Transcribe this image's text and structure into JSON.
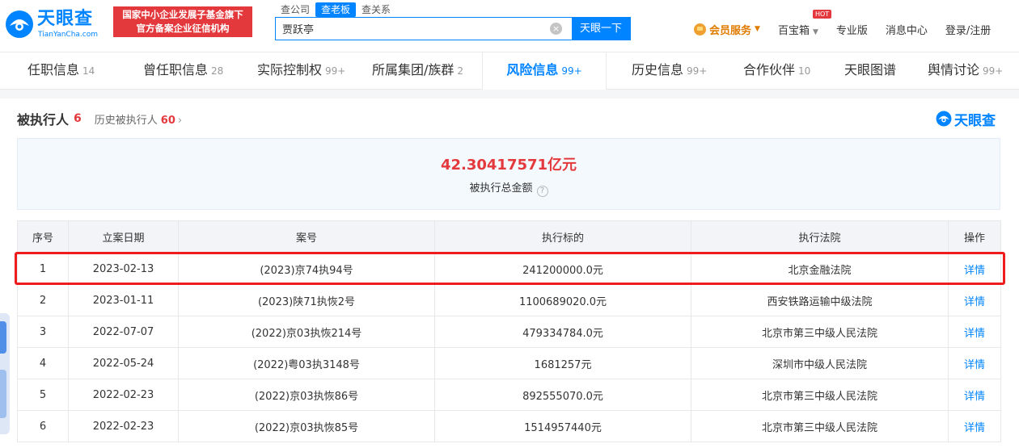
{
  "header": {
    "logo_cn": "天眼查",
    "logo_en": "TianYanCha.com",
    "badge_line1": "国家中小企业发展子基金旗下",
    "badge_line2": "官方备案企业征信机构",
    "search_tabs": [
      "查公司",
      "查老板",
      "查关系"
    ],
    "active_search_tab": "查老板",
    "search_value": "贾跃亭",
    "search_button": "天眼一下",
    "nav": {
      "vip": "会员服务",
      "baibao": "百宝箱",
      "hot": "HOT",
      "pro": "专业版",
      "messages": "消息中心",
      "login": "登录/注册"
    }
  },
  "tabs": [
    {
      "label": "任职信息",
      "count": "14"
    },
    {
      "label": "曾任职信息",
      "count": "28"
    },
    {
      "label": "实际控制权",
      "count": "99+"
    },
    {
      "label": "所属集团/族群",
      "count": "2"
    },
    {
      "label": "风险信息",
      "count": "99+"
    },
    {
      "label": "历史信息",
      "count": "99+"
    },
    {
      "label": "合作伙伴",
      "count": "10"
    },
    {
      "label": "天眼图谱",
      "count": ""
    },
    {
      "label": "舆情讨论",
      "count": "99+"
    }
  ],
  "active_tab": "风险信息",
  "section": {
    "title": "被执行人",
    "count": "6",
    "history_label": "历史被执行人",
    "history_count": "60",
    "brand": "天眼查"
  },
  "summary": {
    "amount": "42.30417571亿元",
    "label": "被执行总金额"
  },
  "table": {
    "headers": [
      "序号",
      "立案日期",
      "案号",
      "执行标的",
      "执行法院",
      "操作"
    ],
    "rows": [
      [
        "1",
        "2023-02-13",
        "(2023)京74执94号",
        "241200000.0元",
        "北京金融法院",
        "详情"
      ],
      [
        "2",
        "2023-01-11",
        "(2023)陕71执恢2号",
        "1100689020.0元",
        "西安铁路运输中级法院",
        "详情"
      ],
      [
        "3",
        "2022-07-07",
        "(2022)京03执恢214号",
        "479334784.0元",
        "北京市第三中级人民法院",
        "详情"
      ],
      [
        "4",
        "2022-05-24",
        "(2022)粤03执3148号",
        "1681257元",
        "深圳市中级人民法院",
        "详情"
      ],
      [
        "5",
        "2022-02-23",
        "(2022)京03执恢86号",
        "892555070.0元",
        "北京市第三中级人民法院",
        "详情"
      ],
      [
        "6",
        "2022-02-23",
        "(2022)京03执恢85号",
        "1514957440元",
        "北京市第三中级人民法院",
        "详情"
      ]
    ],
    "highlighted_row": 1
  },
  "colors": {
    "brand_blue": "#0084ff",
    "alert_red": "#e4393c",
    "highlight_red": "#ee1c1c",
    "vip_orange": "#e07b00"
  }
}
